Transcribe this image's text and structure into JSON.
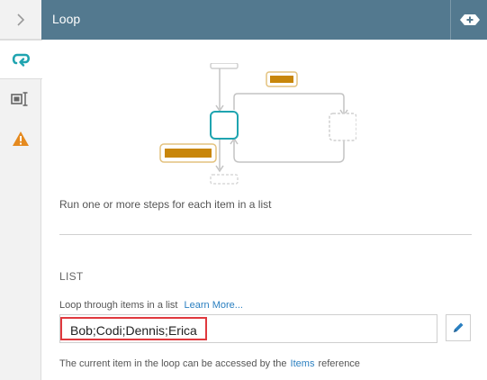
{
  "header": {
    "title": "Loop",
    "action_icon": "add-tag-icon"
  },
  "rail": {
    "toggle_icon": "chevron-right-icon",
    "items": [
      {
        "icon": "loop-icon",
        "active": true
      },
      {
        "icon": "input-field-icon",
        "active": false
      },
      {
        "icon": "warning-icon",
        "active": false
      }
    ]
  },
  "main": {
    "description": "Run one or more steps for each item in a list",
    "section_title": "LIST",
    "field_label": "Loop through items in a list",
    "learn_more": "Learn More...",
    "list_value": "Bob;Codi;Dennis;Erica",
    "edit_icon": "pencil-icon",
    "hint_prefix": "The current item in the loop can be accessed by the",
    "hint_link": "Items",
    "hint_suffix": "reference"
  },
  "colors": {
    "header_bg": "#53798f",
    "accent_teal": "#1fa4b0",
    "highlight_border": "#e0393e",
    "link": "#2a7fc0",
    "diagram_orange": "#c8860a"
  }
}
